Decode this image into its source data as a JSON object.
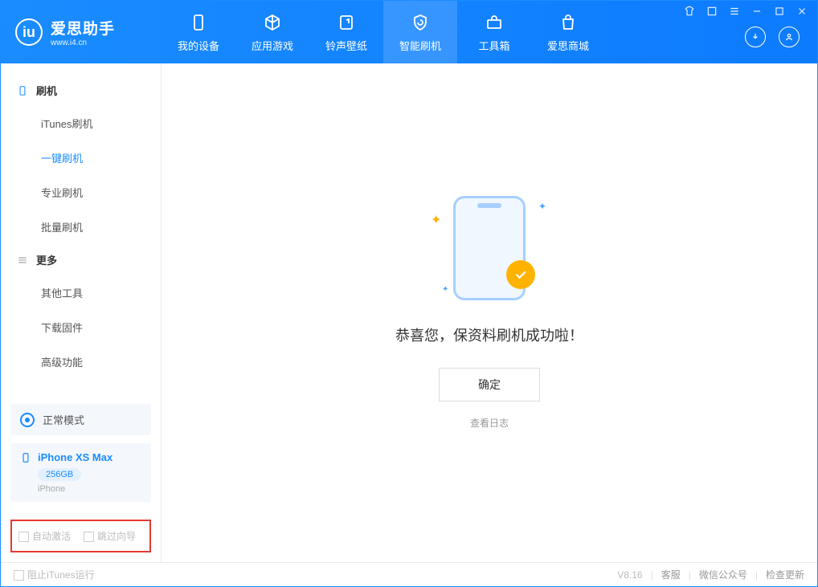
{
  "app": {
    "title": "爱思助手",
    "subtitle": "www.i4.cn"
  },
  "nav": {
    "items": [
      {
        "label": "我的设备"
      },
      {
        "label": "应用游戏"
      },
      {
        "label": "铃声壁纸"
      },
      {
        "label": "智能刷机"
      },
      {
        "label": "工具箱"
      },
      {
        "label": "爱思商城"
      }
    ]
  },
  "sidebar": {
    "group_flash": "刷机",
    "flash_items": [
      {
        "label": "iTunes刷机"
      },
      {
        "label": "一键刷机"
      },
      {
        "label": "专业刷机"
      },
      {
        "label": "批量刷机"
      }
    ],
    "group_more": "更多",
    "more_items": [
      {
        "label": "其他工具"
      },
      {
        "label": "下载固件"
      },
      {
        "label": "高级功能"
      }
    ],
    "mode": "正常模式",
    "device_name": "iPhone XS Max",
    "device_storage": "256GB",
    "device_type": "iPhone",
    "option_auto_activate": "自动激活",
    "option_skip_guide": "跳过向导"
  },
  "main": {
    "success_text": "恭喜您，保资料刷机成功啦！",
    "ok_label": "确定",
    "log_link": "查看日志"
  },
  "footer": {
    "block_itunes": "阻止iTunes运行",
    "version": "V8.16",
    "links": [
      "客服",
      "微信公众号",
      "检查更新"
    ]
  }
}
